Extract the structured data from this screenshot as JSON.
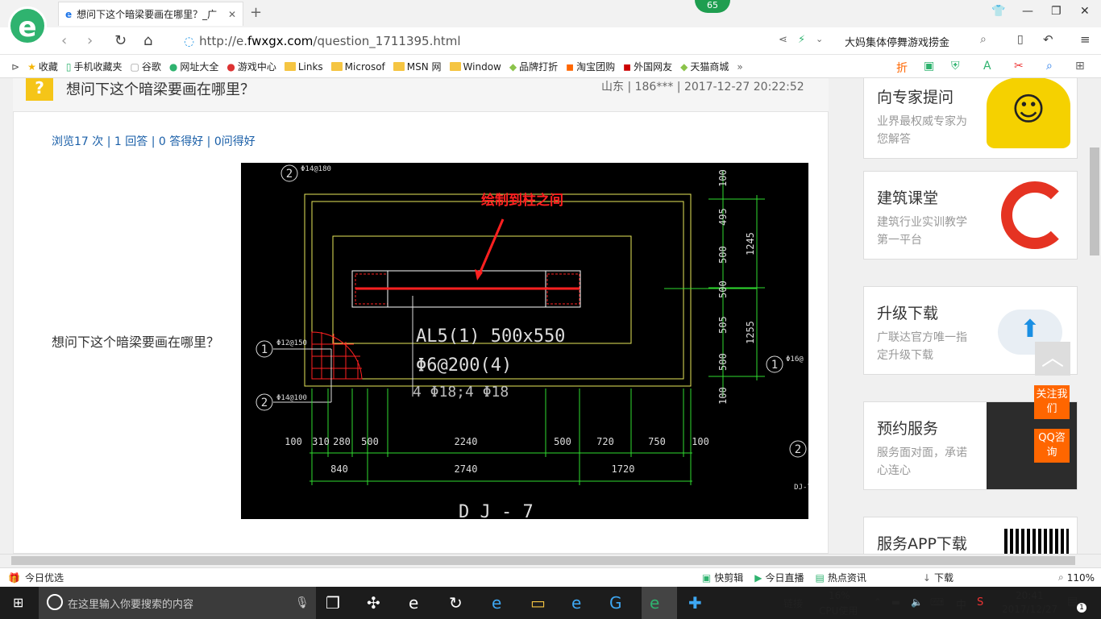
{
  "browser": {
    "tab_title": "想问下这个暗梁要画在哪里？_广",
    "badge": "65",
    "url_prefix": "http://e.",
    "url_domain": "fwxgx.com",
    "url_path": "/question_1711395.html",
    "search_text": "大妈集体停舞游戏捞金",
    "zoom": "110%"
  },
  "bookmarks": [
    "收藏",
    "手机收藏夹",
    "谷歌",
    "网址大全",
    "游戏中心",
    "Links",
    "Microsof",
    "MSN 网",
    "Window",
    "品牌打折",
    "淘宝团购",
    "外国网友",
    "天猫商城"
  ],
  "question": {
    "title": "想问下这个暗梁要画在哪里？",
    "meta": "山东 | 186*** | 2017-12-27 20:22:52",
    "stats": "浏览17 次 | 1 回答 | 0 答得好 | 0问得好",
    "body": "想问下这个暗梁要画在哪里？"
  },
  "cad": {
    "annotation": "绘制到柱之间",
    "beam_label": "AL5(1) 500x550",
    "stirrup": "Φ6@200(4)",
    "rebar": "4 Φ18;4 Φ18",
    "bar1": "Φ14@180",
    "bar2": "Φ12@150",
    "bar3": "Φ14@100",
    "bar4": "Φ16@",
    "dims_top": [
      "100",
      "310",
      "280",
      "500",
      "2240",
      "500",
      "720",
      "750",
      "100"
    ],
    "dims_bottom": [
      "840",
      "2740",
      "1720"
    ],
    "dims_right": [
      "100",
      "495",
      "500",
      "500",
      "505",
      "500",
      "100"
    ],
    "dims_right2": [
      "1245",
      "1255"
    ],
    "circles": [
      "2",
      "1",
      "2",
      "1",
      "2"
    ],
    "sheet": "DJ-7"
  },
  "sidebar": [
    {
      "title": "向专家提问",
      "desc": "业界最权威专家为您解答"
    },
    {
      "title": "建筑课堂",
      "desc": "建筑行业实训教学第一平台"
    },
    {
      "title": "升级下载",
      "desc": "广联达官方唯一指定升级下载"
    },
    {
      "title": "预约服务",
      "desc": "服务面对面，承诺心连心"
    },
    {
      "title": "服务APP下载",
      "desc": ""
    }
  ],
  "float": {
    "follow": "关注我们",
    "qq": "QQ咨询"
  },
  "statusbar": {
    "left": "今日优选",
    "items": [
      "快剪辑",
      "今日直播",
      "热点资讯",
      "下载"
    ]
  },
  "taskbar": {
    "search_placeholder": "在这里输入你要搜索的内容",
    "link": "链接",
    "cpu": "16%",
    "cpu_label": "CPU使用",
    "ime": "中",
    "time": "20:41",
    "date": "2017/12/27",
    "notif": "1"
  },
  "colors": {
    "cad_bg": "#000000",
    "cad_yellow": "#e8e85a",
    "cad_green": "#2fdc2f",
    "cad_red": "#ff2020",
    "accent": "#2fb36f"
  }
}
